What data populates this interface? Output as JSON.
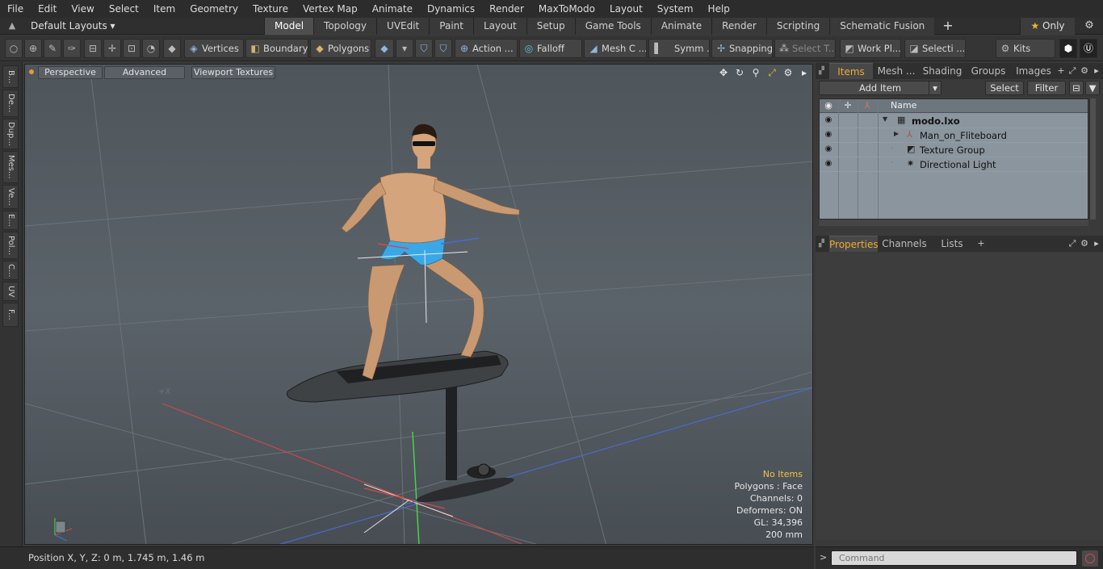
{
  "menu": [
    "File",
    "Edit",
    "View",
    "Select",
    "Item",
    "Geometry",
    "Texture",
    "Vertex Map",
    "Animate",
    "Dynamics",
    "Render",
    "MaxToModo",
    "Layout",
    "System",
    "Help"
  ],
  "layout": {
    "dropdown": "Default Layouts ▾",
    "tabs": [
      {
        "label": "Model",
        "active": true
      },
      {
        "label": "Topology"
      },
      {
        "label": "UVEdit"
      },
      {
        "label": "Paint"
      },
      {
        "label": "Layout"
      },
      {
        "label": "Setup"
      },
      {
        "label": "Game Tools"
      },
      {
        "label": "Animate"
      },
      {
        "label": "Render"
      },
      {
        "label": "Scripting"
      },
      {
        "label": "Schematic Fusion"
      }
    ],
    "add_tab": "+",
    "only_label": "Only",
    "star": "★"
  },
  "toolbar": {
    "vertices": "Vertices",
    "boundary": "Boundary",
    "polygons": "Polygons",
    "action": "Action ...",
    "falloff": "Falloff",
    "mesh": "Mesh C ...",
    "symm": "Symm ...",
    "snapping": "Snapping",
    "select_t": "Select T...",
    "work_pl": "Work Pl...",
    "selecti": "Selecti ...",
    "kits": "Kits"
  },
  "left_tabs": [
    "B...",
    "De...",
    "Dup...",
    "Mes...",
    "Ve...",
    "E...",
    "Pol...",
    "C...",
    "UV",
    "F..."
  ],
  "viewport": {
    "view_mode": "Perspective",
    "advanced": "Advanced",
    "textures": "Viewport Textures",
    "info": {
      "no_items": "No Items",
      "polygons": "Polygons : Face",
      "channels": "Channels: 0",
      "deformers": "Deformers: ON",
      "gl": "GL: 34,396",
      "scale": "200 mm"
    },
    "axis_label": "+X"
  },
  "status": {
    "position": "Position X, Y, Z:   0 m, 1.745 m, 1.46 m"
  },
  "items_panel": {
    "tabs": [
      {
        "label": "Items",
        "active": true
      },
      {
        "label": "Mesh ..."
      },
      {
        "label": "Shading"
      },
      {
        "label": "Groups"
      },
      {
        "label": "Images"
      }
    ],
    "add_item": "Add Item",
    "select": "Select",
    "filter": "Filter",
    "column_name": "Name",
    "rows": [
      {
        "label": "modo.lxo",
        "bold": true
      },
      {
        "label": "Man_on_Fliteboard"
      },
      {
        "label": "Texture Group"
      },
      {
        "label": "Directional Light"
      }
    ]
  },
  "properties_panel": {
    "tabs": [
      {
        "label": "Properties",
        "active": true
      },
      {
        "label": "Channels"
      },
      {
        "label": "Lists"
      }
    ],
    "add": "+"
  },
  "command": {
    "placeholder": "Command"
  },
  "colors": {
    "accent": "#f0a830",
    "viewport_bg": "#565e65",
    "list_bg": "#8b959d"
  }
}
